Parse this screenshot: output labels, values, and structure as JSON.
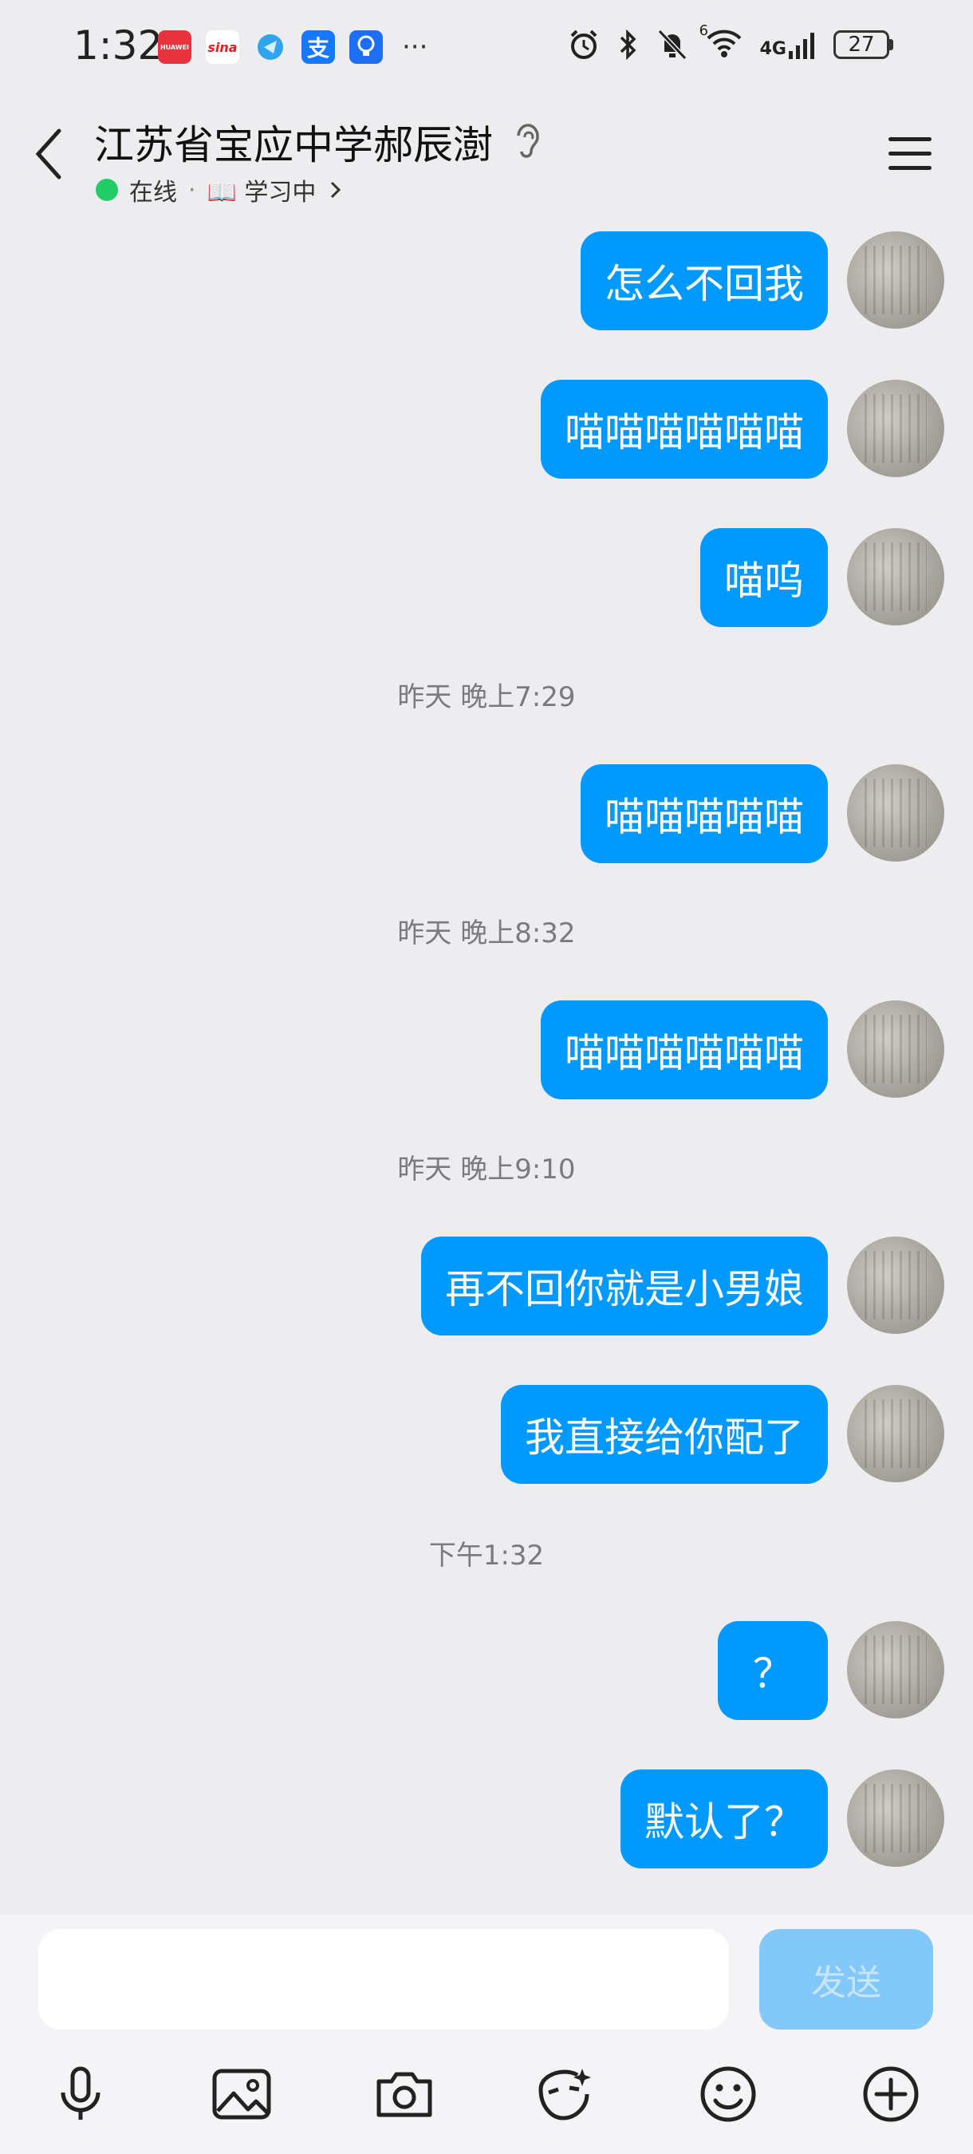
{
  "status_bar": {
    "time": "1:32",
    "app_icons": [
      {
        "name": "huawei-app-icon",
        "label": "HUAWEI",
        "color": "#e8323c"
      },
      {
        "name": "sina-weibo-icon",
        "label": "sina",
        "color": "#ffffff"
      },
      {
        "name": "browser-icon",
        "label": "",
        "color": "#2fa5f0"
      },
      {
        "name": "alipay-icon",
        "label": "支",
        "color": "#1677ff"
      },
      {
        "name": "tips-bulb-icon",
        "label": "",
        "color": "#1c6ef2"
      }
    ],
    "more": "···",
    "network": "4G",
    "wifi_label": "6",
    "battery": "27"
  },
  "header": {
    "title": "江苏省宝应中学郝辰澍",
    "online_status": "在线",
    "activity": "📖 学习中",
    "separator": "·"
  },
  "messages": [
    {
      "type": "bubble",
      "text": "怎么不回我"
    },
    {
      "type": "bubble",
      "text": "喵喵喵喵喵喵"
    },
    {
      "type": "bubble",
      "text": "喵呜"
    },
    {
      "type": "time",
      "text": "昨天 晚上7:29"
    },
    {
      "type": "bubble",
      "text": "喵喵喵喵喵"
    },
    {
      "type": "time",
      "text": "昨天 晚上8:32"
    },
    {
      "type": "bubble",
      "text": "喵喵喵喵喵喵"
    },
    {
      "type": "time",
      "text": "昨天 晚上9:10"
    },
    {
      "type": "bubble",
      "text": "再不回你就是小男娘"
    },
    {
      "type": "bubble",
      "text": "我直接给你配了"
    },
    {
      "type": "time",
      "text": "下午1:32"
    },
    {
      "type": "bubble",
      "text": "？"
    },
    {
      "type": "bubble",
      "text": "默认了？"
    }
  ],
  "input": {
    "placeholder": "",
    "send_label": "发送"
  },
  "toolbar": [
    "microphone-icon",
    "image-icon",
    "camera-icon",
    "sticker-icon",
    "emoji-icon",
    "plus-icon"
  ],
  "colors": {
    "bubble": "#0099ff",
    "background": "#ededf0",
    "send_disabled": "#82c8f8",
    "online_dot": "#22cc66"
  }
}
